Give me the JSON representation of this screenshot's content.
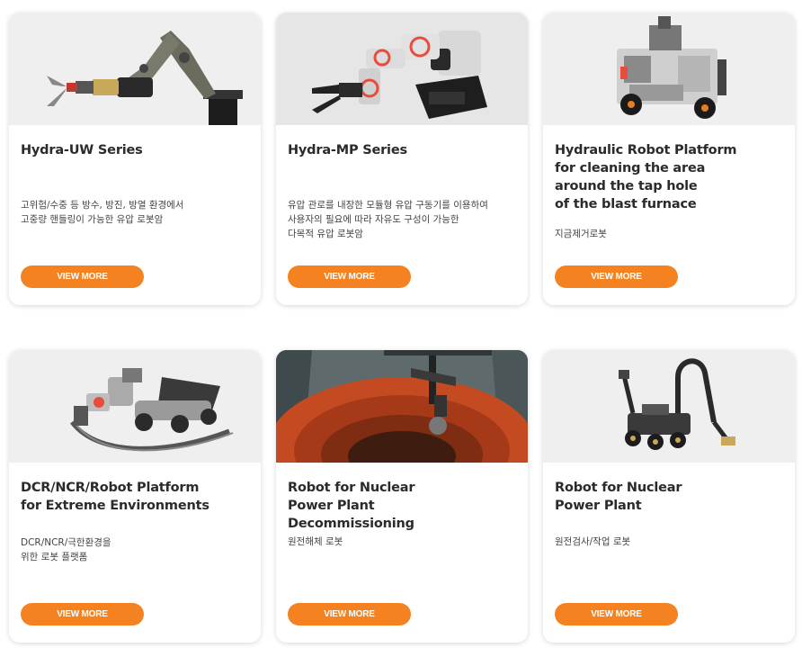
{
  "colors": {
    "accent": "#f58220",
    "card_bg": "#ffffff",
    "image_bg": "#efefef"
  },
  "cards": [
    {
      "title": "Hydra-UW Series",
      "description": "고위험/수중 등 방수, 방진, 방열 환경에서\n고중량 핸들링이 가능한 유압 로봇암",
      "image": "hydraulic-robot-arm-image",
      "button": "VIEW MORE"
    },
    {
      "title": "Hydra-MP Series",
      "description": "유압 관로를 내장한 모듈형 유압 구동기를 이용하여\n사용자의 필요에 따라 자유도 구성이 가능한\n다목적 유압 로봇암",
      "image": "modular-robot-arm-image",
      "button": "VIEW MORE"
    },
    {
      "title": "Hydraulic Robot Platform\nfor cleaning the area\naround the tap hole\nof the blast furnace",
      "description": "지금제거로봇",
      "image": "blast-furnace-platform-image",
      "button": "VIEW MORE"
    },
    {
      "title": "DCR/NCR/Robot Platform\nfor Extreme Environments",
      "description": "DCR/NCR/극한환경을\n위한 로봇 플랫폼",
      "image": "extreme-environment-platform-image",
      "button": "VIEW MORE"
    },
    {
      "title": "Robot for Nuclear\nPower Plant\nDecommissioning",
      "description": "원전해체 로봇",
      "image": "nuclear-decommissioning-image",
      "button": "VIEW MORE"
    },
    {
      "title": "Robot for Nuclear\nPower Plant",
      "description": "원전검사/작업 로봇",
      "image": "nuclear-inspection-robot-image",
      "button": "VIEW MORE"
    }
  ]
}
